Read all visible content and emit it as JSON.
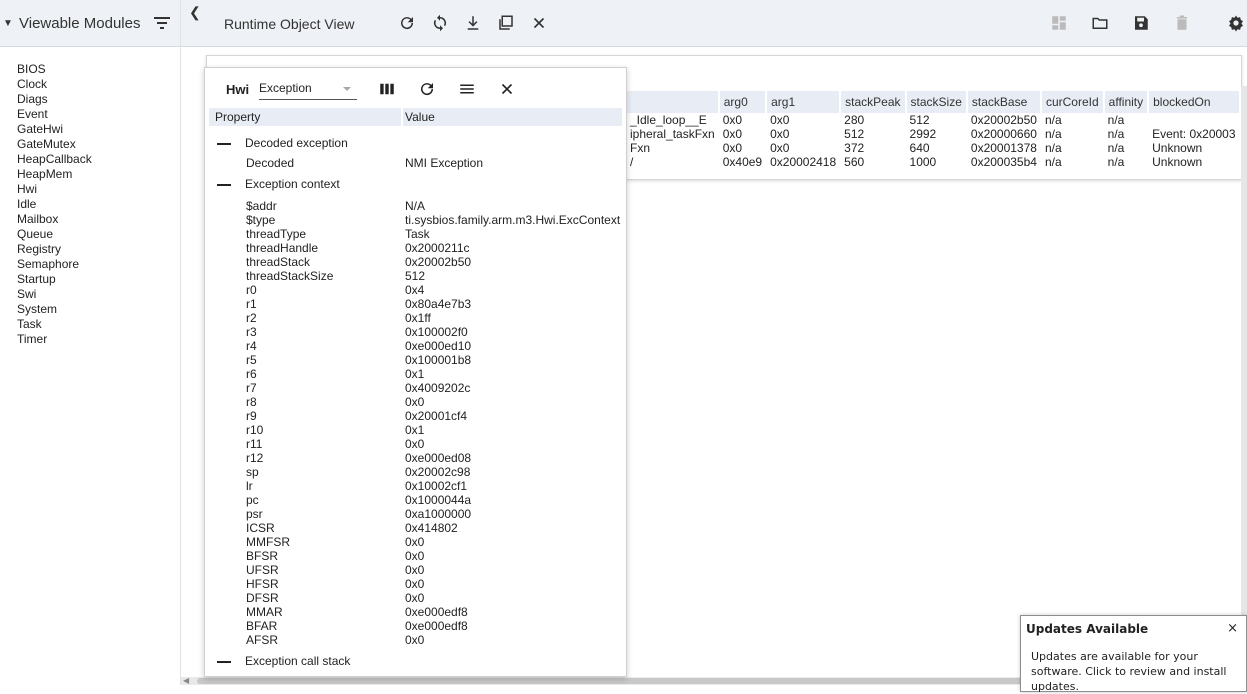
{
  "sidebar": {
    "title": "Viewable Modules",
    "modules": [
      "BIOS",
      "Clock",
      "Diags",
      "Event",
      "GateHwi",
      "GateMutex",
      "HeapCallback",
      "HeapMem",
      "Hwi",
      "Idle",
      "Mailbox",
      "Queue",
      "Registry",
      "Semaphore",
      "Startup",
      "Swi",
      "System",
      "Task",
      "Timer"
    ]
  },
  "toolbar": {
    "view_title": "Runtime Object View"
  },
  "task_table": {
    "columns": [
      "",
      "arg0",
      "arg1",
      "stackPeak",
      "stackSize",
      "stackBase",
      "curCoreId",
      "affinity",
      "blockedOn"
    ],
    "rows": [
      [
        "_Idle_loop__E",
        "0x0",
        "0x0",
        "280",
        "512",
        "0x20002b50",
        "n/a",
        "n/a",
        ""
      ],
      [
        "ipheral_taskFxn",
        "0x0",
        "0x0",
        "512",
        "2992",
        "0x20000660",
        "n/a",
        "n/a",
        "Event: 0x20003"
      ],
      [
        "Fxn",
        "0x0",
        "0x0",
        "372",
        "640",
        "0x20001378",
        "n/a",
        "n/a",
        "Unknown"
      ],
      [
        "/",
        "0x40e9",
        "0x20002418",
        "560",
        "1000",
        "0x200035b4",
        "n/a",
        "n/a",
        "Unknown"
      ]
    ]
  },
  "hwi_window": {
    "module_label": "Hwi",
    "selected_view": "Exception",
    "col_property": "Property",
    "col_value": "Value",
    "decoded_section": "Decoded exception",
    "decoded_row": {
      "k": "Decoded",
      "v": "NMI Exception"
    },
    "context_section": "Exception context",
    "context_rows": [
      {
        "k": "$addr",
        "v": "N/A"
      },
      {
        "k": "$type",
        "v": "ti.sysbios.family.arm.m3.Hwi.ExcContext"
      },
      {
        "k": "threadType",
        "v": "Task"
      },
      {
        "k": "threadHandle",
        "v": "0x2000211c"
      },
      {
        "k": "threadStack",
        "v": "0x20002b50"
      },
      {
        "k": "threadStackSize",
        "v": "512"
      },
      {
        "k": "r0",
        "v": "0x4"
      },
      {
        "k": "r1",
        "v": "0x80a4e7b3"
      },
      {
        "k": "r2",
        "v": "0x1ff"
      },
      {
        "k": "r3",
        "v": "0x100002f0"
      },
      {
        "k": "r4",
        "v": "0xe000ed10"
      },
      {
        "k": "r5",
        "v": "0x100001b8"
      },
      {
        "k": "r6",
        "v": "0x1"
      },
      {
        "k": "r7",
        "v": "0x4009202c"
      },
      {
        "k": "r8",
        "v": "0x0"
      },
      {
        "k": "r9",
        "v": "0x20001cf4"
      },
      {
        "k": "r10",
        "v": "0x1"
      },
      {
        "k": "r11",
        "v": "0x0"
      },
      {
        "k": "r12",
        "v": "0xe000ed08"
      },
      {
        "k": "sp",
        "v": "0x20002c98"
      },
      {
        "k": "lr",
        "v": "0x10002cf1"
      },
      {
        "k": "pc",
        "v": "0x1000044a"
      },
      {
        "k": "psr",
        "v": "0xa1000000"
      },
      {
        "k": "ICSR",
        "v": "0x414802"
      },
      {
        "k": "MMFSR",
        "v": "0x0"
      },
      {
        "k": "BFSR",
        "v": "0x0"
      },
      {
        "k": "UFSR",
        "v": "0x0"
      },
      {
        "k": "HFSR",
        "v": "0x0"
      },
      {
        "k": "DFSR",
        "v": "0x0"
      },
      {
        "k": "MMAR",
        "v": "0xe000edf8"
      },
      {
        "k": "BFAR",
        "v": "0xe000edf8"
      },
      {
        "k": "AFSR",
        "v": "0x0"
      }
    ],
    "callstack_section": "Exception call stack"
  },
  "notification": {
    "title": "Updates Available",
    "close": "×",
    "message": "Updates are available for your software. Click to review and install updates."
  },
  "colors": {
    "toolbar_bg": "#eef1f6",
    "header_bg": "#e8edf5",
    "icon_dark": "#333333",
    "icon_disabled": "#bbbbbb"
  },
  "icons": [
    "chevron-left-icon",
    "refresh-icon",
    "sync-icon",
    "download-icon",
    "copy-icon",
    "close-icon",
    "dashboard-icon",
    "folder-icon",
    "save-icon",
    "delete-icon",
    "settings-icon",
    "filter-icon",
    "columns-icon",
    "menu-icon"
  ]
}
